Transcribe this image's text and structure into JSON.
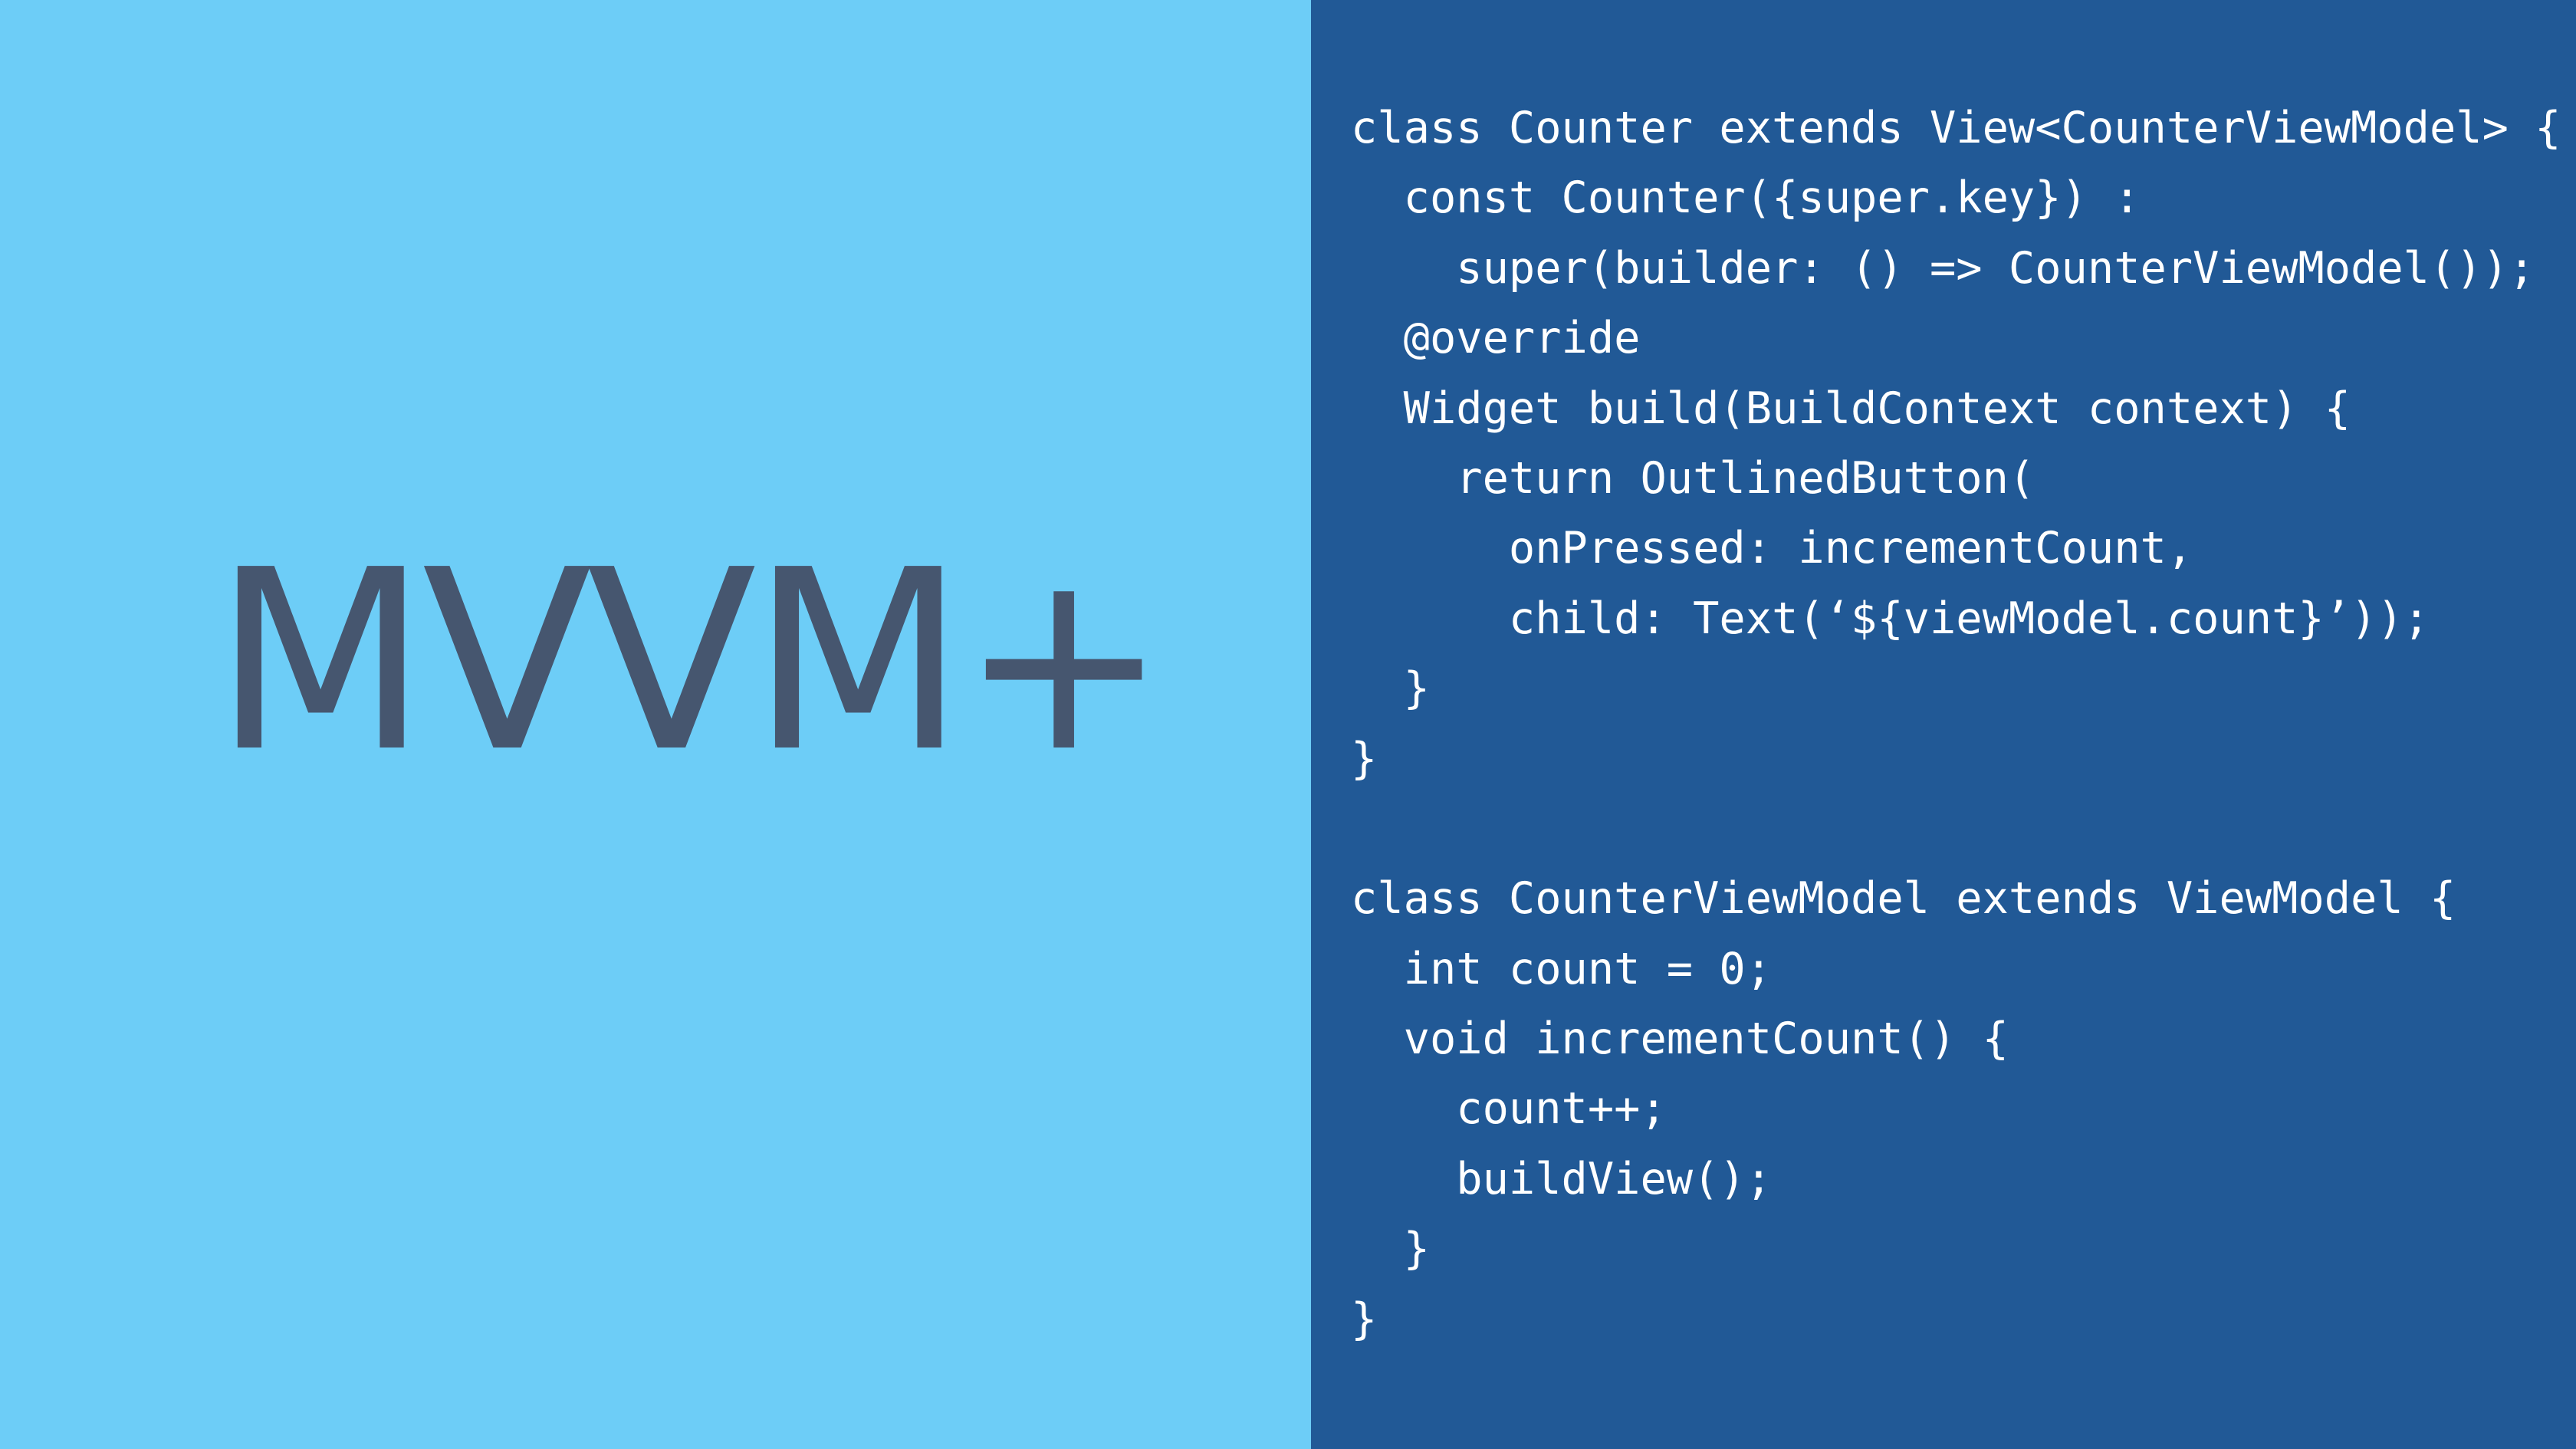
{
  "slide": {
    "title": "MVVM+",
    "colors": {
      "left_background": "#6dcdf7",
      "right_background": "#215996",
      "title_color": "#46566f",
      "code_color": "#ffffff"
    },
    "code_lines": [
      "class Counter extends View<CounterViewModel> {",
      "  const Counter({super.key}) :",
      "    super(builder: () => CounterViewModel());",
      "  @override",
      "  Widget build(BuildContext context) {",
      "    return OutlinedButton(",
      "      onPressed: incrementCount,",
      "      child: Text(‘${viewModel.count}’));",
      "  }",
      "}",
      "",
      "class CounterViewModel extends ViewModel {",
      "  int count = 0;",
      "  void incrementCount() {",
      "    count++;",
      "    buildView();",
      "  }",
      "}"
    ]
  }
}
